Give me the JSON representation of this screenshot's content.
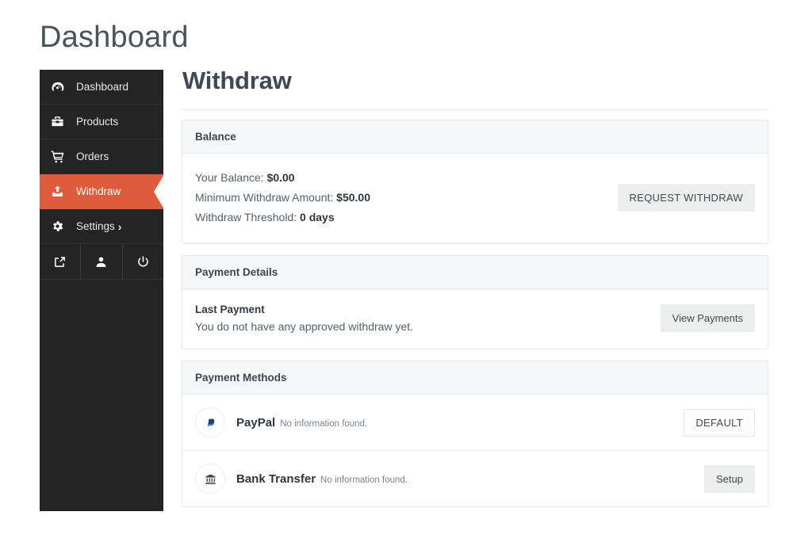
{
  "site": {
    "title": "Dashboard"
  },
  "sidebar": {
    "items": [
      {
        "label": "Dashboard",
        "icon": "speedometer-icon",
        "active": false
      },
      {
        "label": "Products",
        "icon": "toolbox-icon",
        "active": false
      },
      {
        "label": "Orders",
        "icon": "shopping-cart-icon",
        "active": false
      },
      {
        "label": "Withdraw",
        "icon": "upload-icon",
        "active": true
      },
      {
        "label": "Settings",
        "icon": "gear-icon",
        "active": false,
        "chevron": "›"
      }
    ],
    "action_icons": [
      {
        "name": "external-link-icon"
      },
      {
        "name": "user-icon"
      },
      {
        "name": "power-icon"
      }
    ]
  },
  "main": {
    "page_title": "Withdraw",
    "balance_card": {
      "heading": "Balance",
      "your_balance_label": "Your Balance:",
      "your_balance_value": "$0.00",
      "minimum_label": "Minimum Withdraw Amount:",
      "minimum_value": "$50.00",
      "threshold_label": "Withdraw Threshold:",
      "threshold_value": "0 days",
      "request_button": "REQUEST WITHDRAW"
    },
    "payment_details_card": {
      "heading": "Payment Details",
      "last_payment_title": "Last Payment",
      "last_payment_text": "You do not have any approved withdraw yet.",
      "view_button": "View Payments"
    },
    "payment_methods_card": {
      "heading": "Payment Methods",
      "methods": [
        {
          "name": "PayPal",
          "note": "No information found.",
          "action": "DEFAULT",
          "action_style": "outline",
          "icon": "paypal-icon"
        },
        {
          "name": "Bank Transfer",
          "note": "No information found.",
          "action": "Setup",
          "action_style": "filled",
          "icon": "bank-icon"
        }
      ]
    }
  },
  "colors": {
    "accent": "#de5b3b",
    "sidebar_bg": "#242424",
    "card_head_bg": "#f6f7f8",
    "text_dark": "#3d4550",
    "paypal_blue": "#253b80",
    "paypal_light_blue": "#179bd7"
  }
}
